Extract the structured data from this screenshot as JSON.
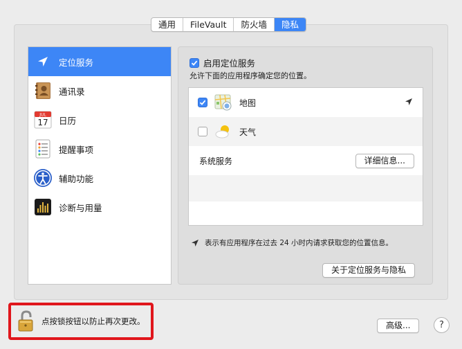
{
  "tabs": [
    {
      "label": "通用",
      "active": false
    },
    {
      "label": "FileVault",
      "active": false
    },
    {
      "label": "防火墙",
      "active": false
    },
    {
      "label": "隐私",
      "active": true
    }
  ],
  "sidebar": {
    "items": [
      {
        "label": "定位服务",
        "icon": "location-arrow-icon",
        "selected": true
      },
      {
        "label": "通讯录",
        "icon": "contacts-book-icon",
        "selected": false
      },
      {
        "label": "日历",
        "icon": "calendar-icon",
        "selected": false
      },
      {
        "label": "提醒事项",
        "icon": "reminders-icon",
        "selected": false
      },
      {
        "label": "辅助功能",
        "icon": "accessibility-icon",
        "selected": false
      },
      {
        "label": "诊断与用量",
        "icon": "diagnostics-icon",
        "selected": false
      }
    ]
  },
  "calendar_icon": {
    "month": "JUL",
    "day": "17"
  },
  "content": {
    "enable_label": "启用定位服务",
    "enable_checked": true,
    "subtitle": "允许下面的应用程序确定您的位置。",
    "apps": [
      {
        "label": "地图",
        "checked": true,
        "icon": "maps-icon",
        "recent_location": true
      },
      {
        "label": "天气",
        "checked": false,
        "icon": "weather-icon",
        "recent_location": false
      }
    ],
    "system_services_label": "系统服务",
    "details_button": "详细信息...",
    "legend_text": "表示有应用程序在过去 24 小时内请求获取您的位置信息。",
    "about_button": "关于定位服务与隐私"
  },
  "footer": {
    "lock_text": "点按锁按钮以防止再次更改。",
    "advanced_button": "高级...",
    "help_button": "?"
  },
  "colors": {
    "accent": "#3d86f6",
    "highlight_border": "#e0161c"
  }
}
